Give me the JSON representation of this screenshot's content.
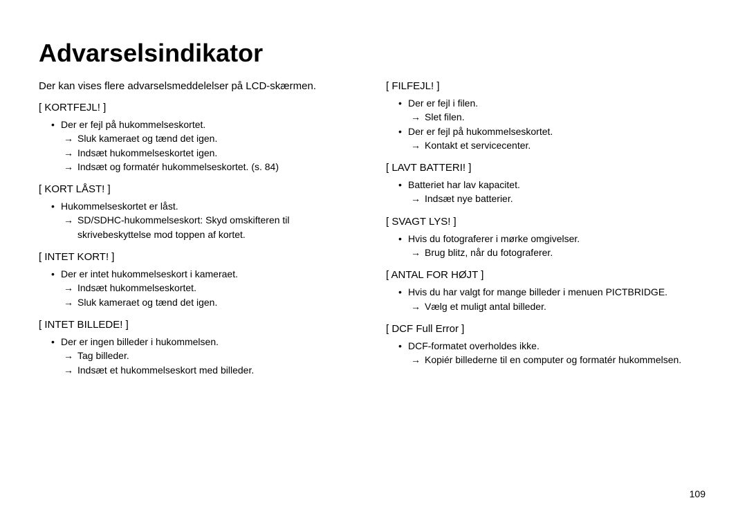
{
  "title": "Advarselsindikator",
  "intro": "Der kan vises flere advarselsmeddelelser på LCD-skærmen.",
  "page_number": "109",
  "left": [
    {
      "heading": "[ KORTFEJL! ]",
      "items": [
        {
          "text": "Der er fejl på hukommelseskortet.",
          "subs": [
            "Sluk kameraet og tænd det igen.",
            "Indsæt hukommelseskortet igen.",
            "Indsæt og formatér hukommelseskortet. (s. 84)"
          ]
        }
      ]
    },
    {
      "heading": "[ KORT LÅST! ]",
      "items": [
        {
          "text": "Hukommelseskortet er låst.",
          "subs": [
            "SD/SDHC-hukommelseskort: Skyd omskifteren til skrivebeskyttelse mod toppen af kortet."
          ]
        }
      ]
    },
    {
      "heading": "[ INTET KORT! ]",
      "items": [
        {
          "text": "Der er intet hukommelseskort i kameraet.",
          "subs": [
            "Indsæt hukommelseskortet.",
            "Sluk kameraet og tænd det igen."
          ]
        }
      ]
    },
    {
      "heading": "[ INTET BILLEDE! ]",
      "items": [
        {
          "text": "Der er ingen billeder i hukommelsen.",
          "subs": [
            "Tag billeder.",
            "Indsæt et hukommelseskort med billeder."
          ]
        }
      ]
    }
  ],
  "right": [
    {
      "heading": "[ FILFEJL! ]",
      "items": [
        {
          "text": "Der er fejl i filen.",
          "subs": [
            "Slet filen."
          ]
        },
        {
          "text": "Der er fejl på hukommelseskortet.",
          "subs": [
            "Kontakt et servicecenter."
          ]
        }
      ]
    },
    {
      "heading": "[ LAVT BATTERI! ]",
      "items": [
        {
          "text": "Batteriet har lav kapacitet.",
          "subs": [
            "Indsæt nye batterier."
          ]
        }
      ]
    },
    {
      "heading": "[ SVAGT LYS! ]",
      "items": [
        {
          "text": "Hvis du fotograferer i mørke omgivelser.",
          "subs": [
            "Brug blitz, når du fotograferer."
          ]
        }
      ]
    },
    {
      "heading": "[ ANTAL FOR HØJT ]",
      "items": [
        {
          "text": "Hvis du har valgt for mange billeder i menuen PICTBRIDGE.",
          "subs": [
            "Vælg et muligt antal billeder."
          ]
        }
      ]
    },
    {
      "heading": "[ DCF Full Error ]",
      "items": [
        {
          "text": "DCF-formatet overholdes ikke.",
          "subs": [
            "Kopiér billederne til en computer og formatér hukommelsen."
          ]
        }
      ]
    }
  ]
}
